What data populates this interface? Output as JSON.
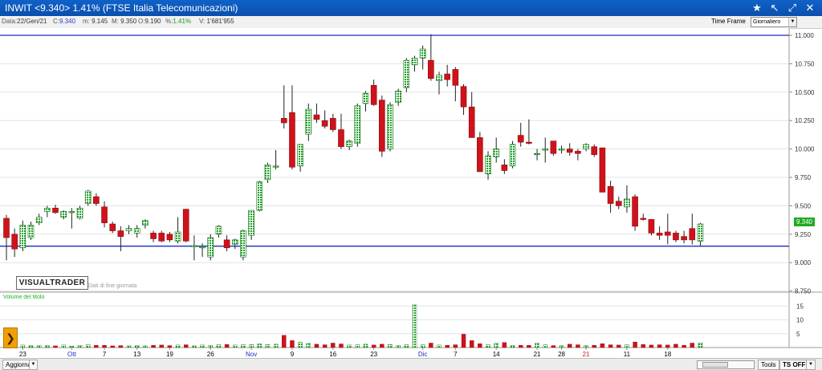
{
  "window": {
    "title": "INWIT <9.340> 1.41%   (FTSE Italia Telecomunicazioni)",
    "icons": [
      "star-icon",
      "pointer-icon",
      "expand-icon",
      "close-icon"
    ]
  },
  "info": {
    "data_label": "Data:",
    "data_value": "22/Gen/21",
    "c_label": "C:",
    "c_value": "9.340",
    "m_label": "m:",
    "m_value": "9.145",
    "mx_label": "M:",
    "mx_value": "9.350",
    "o_label": "O:",
    "o_value": "9.190",
    "pct_label": "%:",
    "pct_value": "1.41%",
    "v_label": "V:",
    "v_value": "1'681'955"
  },
  "timeframe": {
    "label": "Time Frame",
    "value": "Giornaliero"
  },
  "logo": {
    "text": "VISUALTRADER",
    "subtitle": "Dati di fine giornata"
  },
  "volume_label": "Volume del titolo",
  "last_price_tag": "9.340",
  "bottom": {
    "update_label": "Aggiorna",
    "tools_label": "Tools",
    "tsoff_label": "TS OFF"
  },
  "colors": {
    "up": "#1fa325",
    "down": "#d0121a",
    "hline": "#1a2cc0",
    "titlebar": "#0f62c9"
  },
  "chart_data": {
    "type": "candlestick",
    "price_ylim": [
      8.75,
      11.0
    ],
    "price_ticks": [
      "11.000",
      "10.750",
      "10.500",
      "10.250",
      "10.000",
      "9.750",
      "9.500",
      "9.250",
      "9.000",
      "8.750"
    ],
    "volume_ylim": [
      0,
      16
    ],
    "volume_ticks": [
      "15",
      "10",
      "5"
    ],
    "horizontal_lines": [
      11.0,
      9.145
    ],
    "x_labels": [
      {
        "label": "23",
        "index": 2,
        "color": "#000"
      },
      {
        "label": "Ott",
        "index": 8,
        "color": "#1a2cc0"
      },
      {
        "label": "7",
        "index": 12,
        "color": "#000"
      },
      {
        "label": "13",
        "index": 16,
        "color": "#000"
      },
      {
        "label": "19",
        "index": 20,
        "color": "#000"
      },
      {
        "label": "26",
        "index": 25,
        "color": "#000"
      },
      {
        "label": "Nov",
        "index": 30,
        "color": "#1a2cc0"
      },
      {
        "label": "9",
        "index": 35,
        "color": "#000"
      },
      {
        "label": "16",
        "index": 40,
        "color": "#000"
      },
      {
        "label": "23",
        "index": 45,
        "color": "#000"
      },
      {
        "label": "Dic",
        "index": 51,
        "color": "#1a2cc0"
      },
      {
        "label": "7",
        "index": 55,
        "color": "#000"
      },
      {
        "label": "14",
        "index": 60,
        "color": "#000"
      },
      {
        "label": "21",
        "index": 65,
        "color": "#000"
      },
      {
        "label": "28",
        "index": 68,
        "color": "#000"
      },
      {
        "label": "21",
        "index": 71,
        "color": "#d0121a"
      },
      {
        "label": "11",
        "index": 76,
        "color": "#000"
      },
      {
        "label": "18",
        "index": 81,
        "color": "#000"
      }
    ],
    "candles": [
      {
        "o": 9.39,
        "h": 9.42,
        "l": 9.02,
        "c": 9.22,
        "v": 1.6
      },
      {
        "o": 9.25,
        "h": 9.3,
        "l": 9.05,
        "c": 9.12,
        "v": 1.0
      },
      {
        "o": 9.13,
        "h": 9.37,
        "l": 9.1,
        "c": 9.33,
        "v": 0.9
      },
      {
        "o": 9.22,
        "h": 9.36,
        "l": 9.2,
        "c": 9.33,
        "v": 0.7
      },
      {
        "o": 9.35,
        "h": 9.43,
        "l": 9.33,
        "c": 9.4,
        "v": 0.7
      },
      {
        "o": 9.45,
        "h": 9.5,
        "l": 9.4,
        "c": 9.48,
        "v": 0.8
      },
      {
        "o": 9.48,
        "h": 9.51,
        "l": 9.43,
        "c": 9.44,
        "v": 0.6
      },
      {
        "o": 9.4,
        "h": 9.46,
        "l": 9.38,
        "c": 9.45,
        "v": 0.9
      },
      {
        "o": 9.45,
        "h": 9.48,
        "l": 9.3,
        "c": 9.45,
        "v": 0.5
      },
      {
        "o": 9.39,
        "h": 9.5,
        "l": 9.38,
        "c": 9.48,
        "v": 0.8
      },
      {
        "o": 9.52,
        "h": 9.64,
        "l": 9.5,
        "c": 9.63,
        "v": 1.0
      },
      {
        "o": 9.58,
        "h": 9.61,
        "l": 9.5,
        "c": 9.52,
        "v": 0.8
      },
      {
        "o": 9.49,
        "h": 9.54,
        "l": 9.31,
        "c": 9.35,
        "v": 0.8
      },
      {
        "o": 9.34,
        "h": 9.36,
        "l": 9.26,
        "c": 9.28,
        "v": 0.6
      },
      {
        "o": 9.28,
        "h": 9.32,
        "l": 9.1,
        "c": 9.23,
        "v": 0.7
      },
      {
        "o": 9.28,
        "h": 9.33,
        "l": 9.25,
        "c": 9.3,
        "v": 0.6
      },
      {
        "o": 9.26,
        "h": 9.33,
        "l": 9.22,
        "c": 9.3,
        "v": 0.7
      },
      {
        "o": 9.33,
        "h": 9.38,
        "l": 9.3,
        "c": 9.37,
        "v": 0.6
      },
      {
        "o": 9.26,
        "h": 9.28,
        "l": 9.18,
        "c": 9.21,
        "v": 0.8
      },
      {
        "o": 9.26,
        "h": 9.28,
        "l": 9.18,
        "c": 9.19,
        "v": 0.9
      },
      {
        "o": 9.25,
        "h": 9.27,
        "l": 9.18,
        "c": 9.2,
        "v": 0.7
      },
      {
        "o": 9.19,
        "h": 9.4,
        "l": 9.17,
        "c": 9.27,
        "v": 0.9
      },
      {
        "o": 9.47,
        "h": 9.47,
        "l": 9.18,
        "c": 9.19,
        "v": 1.0
      },
      {
        "o": 9.15,
        "h": 9.24,
        "l": 9.02,
        "c": 9.15,
        "v": 0.6
      },
      {
        "o": 9.13,
        "h": 9.17,
        "l": 9.05,
        "c": 9.14,
        "v": 0.9
      },
      {
        "o": 9.05,
        "h": 9.25,
        "l": 9.02,
        "c": 9.22,
        "v": 0.8
      },
      {
        "o": 9.25,
        "h": 9.33,
        "l": 9.22,
        "c": 9.32,
        "v": 1.0
      },
      {
        "o": 9.2,
        "h": 9.24,
        "l": 9.1,
        "c": 9.13,
        "v": 1.1
      },
      {
        "o": 9.16,
        "h": 9.21,
        "l": 9.12,
        "c": 9.2,
        "v": 0.9
      },
      {
        "o": 9.05,
        "h": 9.29,
        "l": 9.02,
        "c": 9.28,
        "v": 1.0
      },
      {
        "o": 9.24,
        "h": 9.33,
        "l": 9.2,
        "c": 9.46,
        "v": 1.1
      },
      {
        "o": 9.46,
        "h": 9.72,
        "l": 9.45,
        "c": 9.71,
        "v": 1.3
      },
      {
        "o": 9.73,
        "h": 9.88,
        "l": 9.7,
        "c": 9.86,
        "v": 1.1
      },
      {
        "o": 9.85,
        "h": 9.99,
        "l": 9.82,
        "c": 9.85,
        "v": 1.2
      },
      {
        "o": 10.27,
        "h": 10.56,
        "l": 10.18,
        "c": 10.23,
        "v": 4.4
      },
      {
        "o": 10.32,
        "h": 10.56,
        "l": 9.82,
        "c": 9.84,
        "v": 2.5
      },
      {
        "o": 9.85,
        "h": 10.04,
        "l": 9.8,
        "c": 10.04,
        "v": 1.9
      },
      {
        "o": 10.13,
        "h": 10.4,
        "l": 10.07,
        "c": 10.35,
        "v": 1.5
      },
      {
        "o": 10.3,
        "h": 10.4,
        "l": 10.23,
        "c": 10.26,
        "v": 1.2
      },
      {
        "o": 10.25,
        "h": 10.34,
        "l": 10.18,
        "c": 10.2,
        "v": 1.0
      },
      {
        "o": 10.27,
        "h": 10.31,
        "l": 10.15,
        "c": 10.17,
        "v": 1.6
      },
      {
        "o": 10.17,
        "h": 10.31,
        "l": 10.0,
        "c": 10.02,
        "v": 1.3
      },
      {
        "o": 10.02,
        "h": 10.08,
        "l": 9.99,
        "c": 10.07,
        "v": 0.9
      },
      {
        "o": 10.05,
        "h": 10.4,
        "l": 10.02,
        "c": 10.38,
        "v": 1.0
      },
      {
        "o": 10.4,
        "h": 10.51,
        "l": 10.33,
        "c": 10.49,
        "v": 1.2
      },
      {
        "o": 10.56,
        "h": 10.61,
        "l": 10.38,
        "c": 10.39,
        "v": 0.9
      },
      {
        "o": 10.43,
        "h": 10.47,
        "l": 9.93,
        "c": 9.98,
        "v": 1.2
      },
      {
        "o": 10.0,
        "h": 10.41,
        "l": 9.98,
        "c": 10.39,
        "v": 1.1
      },
      {
        "o": 10.41,
        "h": 10.53,
        "l": 10.38,
        "c": 10.51,
        "v": 0.8
      },
      {
        "o": 10.54,
        "h": 10.8,
        "l": 10.5,
        "c": 10.78,
        "v": 1.0
      },
      {
        "o": 10.74,
        "h": 10.82,
        "l": 10.68,
        "c": 10.8,
        "v": 15.4
      },
      {
        "o": 10.8,
        "h": 10.91,
        "l": 10.7,
        "c": 10.88,
        "v": 1.0
      },
      {
        "o": 10.78,
        "h": 11.01,
        "l": 10.6,
        "c": 10.62,
        "v": 1.6
      },
      {
        "o": 10.6,
        "h": 10.68,
        "l": 10.48,
        "c": 10.65,
        "v": 0.9
      },
      {
        "o": 10.66,
        "h": 10.74,
        "l": 10.55,
        "c": 10.61,
        "v": 0.8
      },
      {
        "o": 10.7,
        "h": 10.72,
        "l": 10.42,
        "c": 10.56,
        "v": 1.0
      },
      {
        "o": 10.55,
        "h": 10.57,
        "l": 10.3,
        "c": 10.37,
        "v": 4.8
      },
      {
        "o": 10.37,
        "h": 10.5,
        "l": 10.15,
        "c": 10.1,
        "v": 2.5
      },
      {
        "o": 10.1,
        "h": 10.15,
        "l": 9.8,
        "c": 9.8,
        "v": 1.4
      },
      {
        "o": 9.78,
        "h": 9.98,
        "l": 9.73,
        "c": 9.94,
        "v": 1.0
      },
      {
        "o": 9.93,
        "h": 10.1,
        "l": 9.88,
        "c": 10.0,
        "v": 1.5
      },
      {
        "o": 9.86,
        "h": 9.91,
        "l": 9.78,
        "c": 9.81,
        "v": 1.8
      },
      {
        "o": 9.85,
        "h": 10.07,
        "l": 9.83,
        "c": 10.04,
        "v": 0.8
      },
      {
        "o": 10.12,
        "h": 10.23,
        "l": 10.02,
        "c": 10.06,
        "v": 0.8
      },
      {
        "o": 10.06,
        "h": 10.26,
        "l": 10.04,
        "c": 10.05,
        "v": 0.8
      },
      {
        "o": 9.95,
        "h": 10.0,
        "l": 9.9,
        "c": 9.96,
        "v": 1.6
      },
      {
        "o": 10.0,
        "h": 10.1,
        "l": 9.88,
        "c": 10.0,
        "v": 1.0
      },
      {
        "o": 10.07,
        "h": 10.07,
        "l": 9.94,
        "c": 9.96,
        "v": 0.7
      },
      {
        "o": 10.0,
        "h": 10.03,
        "l": 9.96,
        "c": 10.0,
        "v": 0.7
      },
      {
        "o": 10.0,
        "h": 10.05,
        "l": 9.94,
        "c": 9.97,
        "v": 1.2
      },
      {
        "o": 9.98,
        "h": 10.0,
        "l": 9.9,
        "c": 9.96,
        "v": 1.0
      },
      {
        "o": 10.0,
        "h": 10.05,
        "l": 9.98,
        "c": 10.04,
        "v": 0.7
      },
      {
        "o": 10.02,
        "h": 10.04,
        "l": 9.93,
        "c": 9.95,
        "v": 0.8
      },
      {
        "o": 10.01,
        "h": 10.01,
        "l": 9.62,
        "c": 9.62,
        "v": 1.4
      },
      {
        "o": 9.67,
        "h": 9.72,
        "l": 9.44,
        "c": 9.52,
        "v": 1.0
      },
      {
        "o": 9.54,
        "h": 9.58,
        "l": 9.47,
        "c": 9.5,
        "v": 0.9
      },
      {
        "o": 9.49,
        "h": 9.68,
        "l": 9.44,
        "c": 9.56,
        "v": 1.0
      },
      {
        "o": 9.58,
        "h": 9.6,
        "l": 9.28,
        "c": 9.32,
        "v": 2.0
      },
      {
        "o": 9.39,
        "h": 9.43,
        "l": 9.37,
        "c": 9.38,
        "v": 1.1
      },
      {
        "o": 9.38,
        "h": 9.38,
        "l": 9.24,
        "c": 9.26,
        "v": 0.9
      },
      {
        "o": 9.26,
        "h": 9.32,
        "l": 9.2,
        "c": 9.24,
        "v": 1.0
      },
      {
        "o": 9.27,
        "h": 9.43,
        "l": 9.16,
        "c": 9.24,
        "v": 0.9
      },
      {
        "o": 9.26,
        "h": 9.28,
        "l": 9.18,
        "c": 9.2,
        "v": 1.2
      },
      {
        "o": 9.23,
        "h": 9.28,
        "l": 9.17,
        "c": 9.2,
        "v": 0.8
      },
      {
        "o": 9.3,
        "h": 9.43,
        "l": 9.16,
        "c": 9.2,
        "v": 1.6
      },
      {
        "o": 9.19,
        "h": 9.35,
        "l": 9.15,
        "c": 9.34,
        "v": 1.7
      }
    ]
  }
}
